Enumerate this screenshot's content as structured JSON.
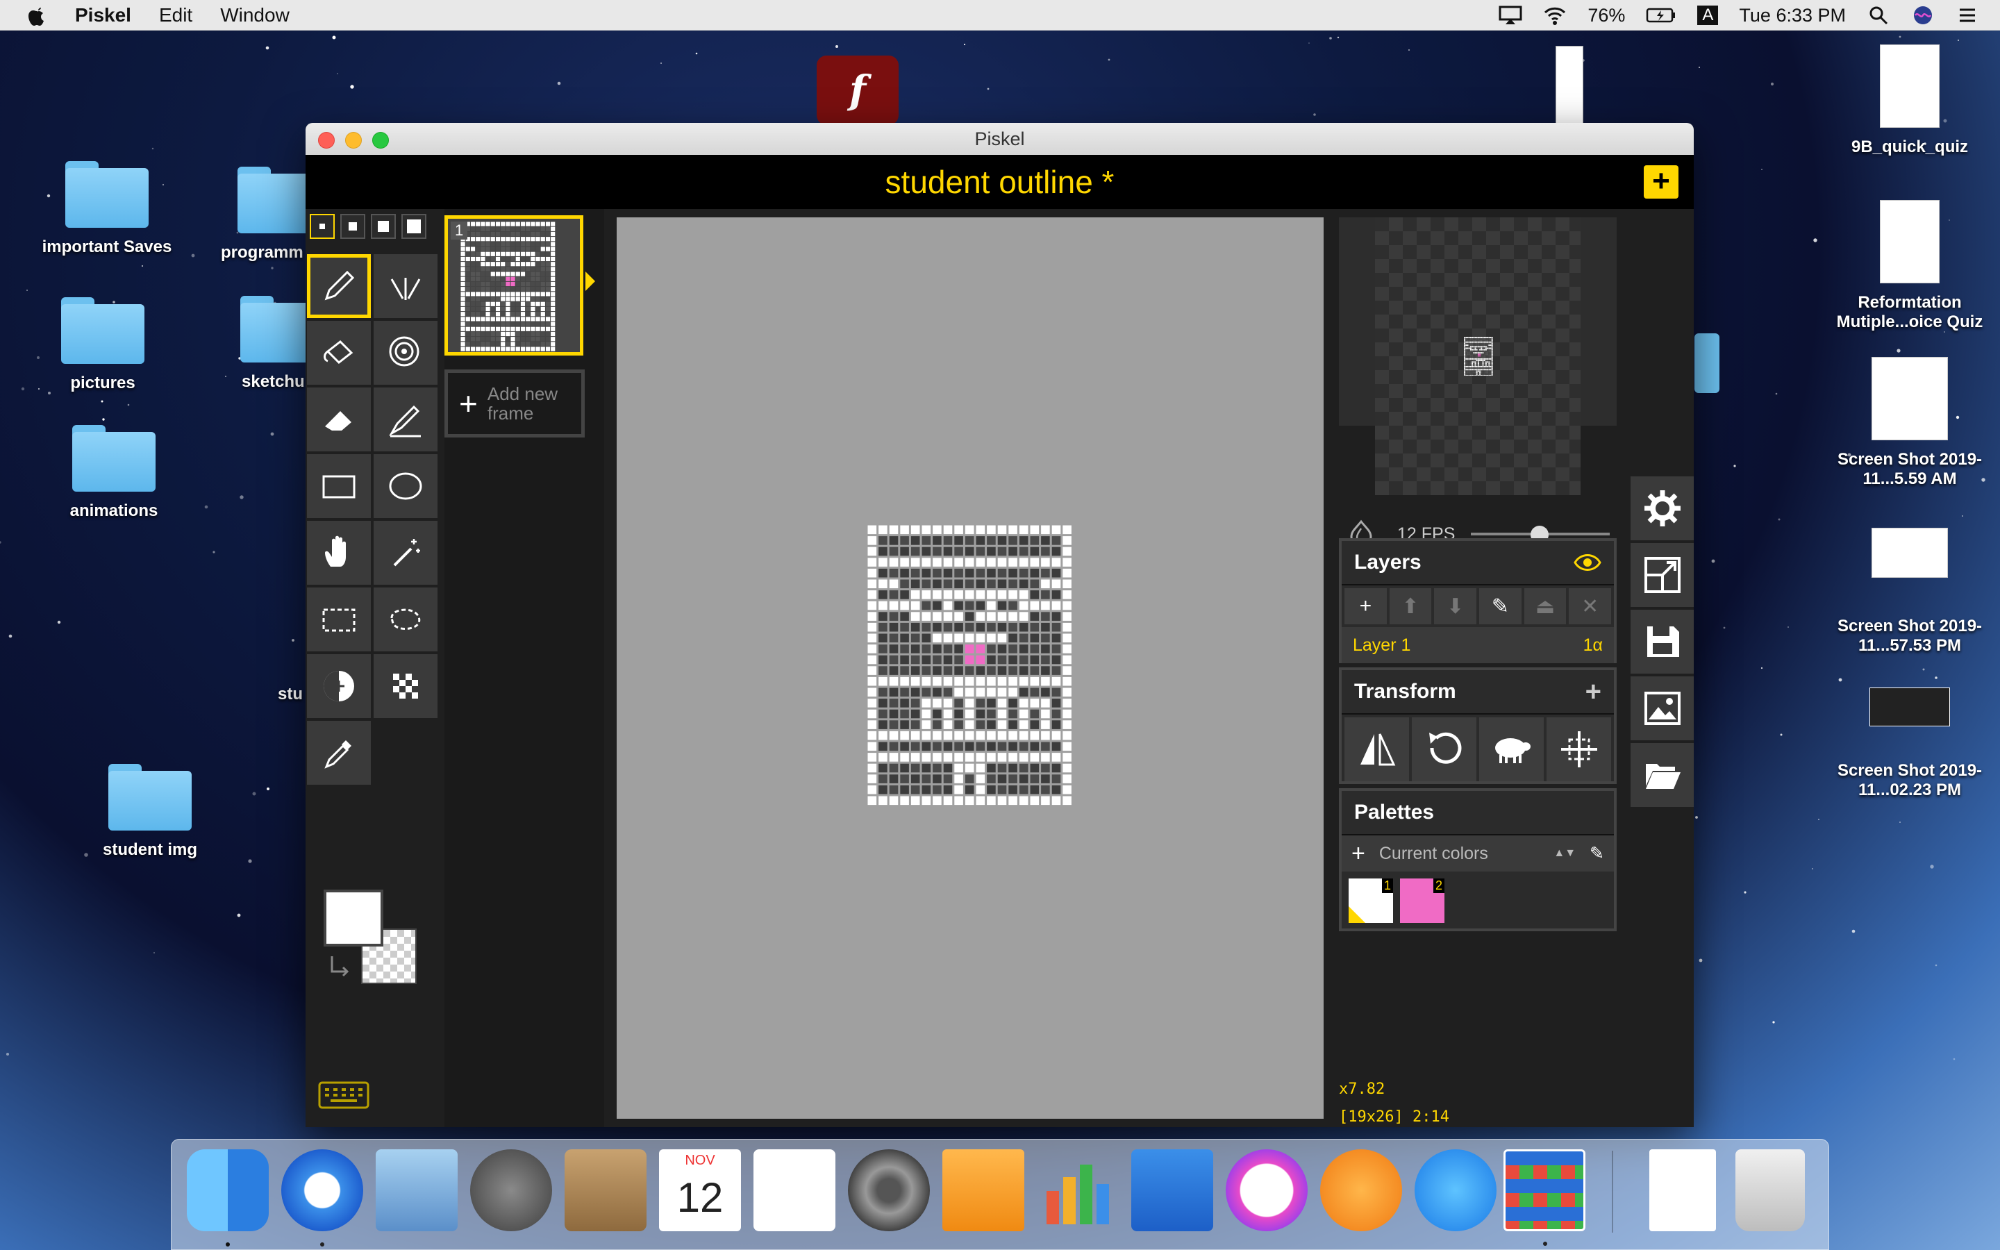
{
  "menubar": {
    "app": "Piskel",
    "items": [
      "Edit",
      "Window"
    ],
    "battery": "76%",
    "time": "Tue 6:33 PM",
    "input_source": "A"
  },
  "desktop_left": [
    {
      "label": "important Saves"
    },
    {
      "label": "programm"
    },
    {
      "label": "pictures"
    },
    {
      "label": "sketchu"
    },
    {
      "label": "animations"
    },
    {
      "label": "stu"
    },
    {
      "label": "student img"
    }
  ],
  "desktop_right": [
    {
      "label": "9B_quick_quiz"
    },
    {
      "label": "Reformtation Mutiple...oice Quiz"
    },
    {
      "label": "Screen Shot 2019-11...5.59 AM"
    },
    {
      "label": "Screen Shot 2019-11...57.53 PM"
    },
    {
      "label": "Screen Shot 2019-11...02.23 PM"
    }
  ],
  "window": {
    "title": "Piskel",
    "document_title": "student outline *"
  },
  "tools": {
    "pen_sizes": [
      "1",
      "2",
      "3",
      "4"
    ],
    "selected_tool": "pen",
    "items": [
      "pen-tool",
      "vertical-mirror-pen",
      "paint-bucket",
      "paint-same-color",
      "eraser",
      "stroke",
      "rectangle",
      "circle",
      "move",
      "shape-selection",
      "rectangle-selection",
      "lasso-selection",
      "lighten",
      "dithering",
      "color-picker"
    ]
  },
  "colors": {
    "primary": "#ffffff",
    "secondary": "transparent"
  },
  "frames": {
    "items": [
      {
        "number": "1"
      }
    ],
    "add_label_1": "Add new",
    "add_label_2": "frame"
  },
  "preview": {
    "fps": "12 FPS",
    "fps_value": 12
  },
  "layers": {
    "title": "Layers",
    "items": [
      {
        "name": "Layer 1",
        "opacity": "1α"
      }
    ]
  },
  "transform": {
    "title": "Transform"
  },
  "palettes": {
    "title": "Palettes",
    "selected": "Current colors",
    "swatches": [
      {
        "n": "1",
        "color": "#ffffff"
      },
      {
        "n": "2",
        "color": "#f06bc5"
      }
    ]
  },
  "status": {
    "zoom": "x7.82",
    "info": "[19x26] 2:14"
  },
  "accent": "#ffd700"
}
